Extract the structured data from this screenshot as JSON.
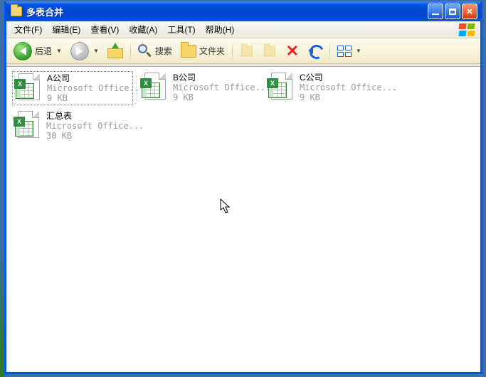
{
  "window": {
    "title": "多表合并"
  },
  "menubar": {
    "file": "文件(F)",
    "edit": "编辑(E)",
    "view": "查看(V)",
    "favorites": "收藏(A)",
    "tools": "工具(T)",
    "help": "帮助(H)"
  },
  "toolbar": {
    "back": "后退",
    "search": "搜索",
    "folders": "文件夹"
  },
  "files": [
    {
      "name": "A公司",
      "type": "Microsoft Office...",
      "size": "9 KB",
      "selected": true
    },
    {
      "name": "B公司",
      "type": "Microsoft Office...",
      "size": "9 KB",
      "selected": false
    },
    {
      "name": "C公司",
      "type": "Microsoft Office...",
      "size": "9 KB",
      "selected": false
    },
    {
      "name": "汇总表",
      "type": "Microsoft Office...",
      "size": "30 KB",
      "selected": false
    }
  ]
}
